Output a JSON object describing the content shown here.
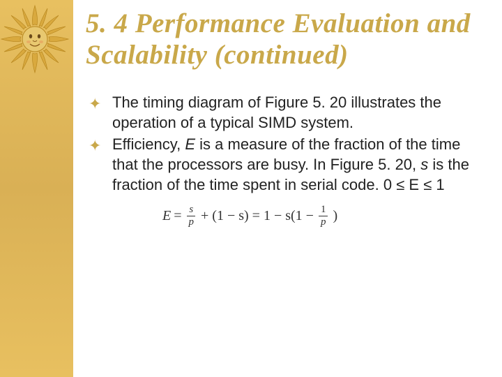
{
  "title": "5. 4 Performance Evaluation and Scalability (continued)",
  "bullets": [
    {
      "text": "The timing diagram of Figure 5. 20 illustrates the operation of a typical SIMD system."
    },
    {
      "pre": "Efficiency, ",
      "var1": "E",
      "mid": " is a measure of the fraction of the time that the processors are busy. In Figure 5. 20, ",
      "var2": "s",
      "post": " is the fraction of the time spent in serial code.  0 ≤ E ≤ 1"
    }
  ],
  "formula": {
    "lhs": "E",
    "eq1": "=",
    "f1num": "s",
    "f1den": "p",
    "plus": "+ (1 − s) = 1 − s(1 −",
    "f2num": "1",
    "f2den": "p",
    "close": ")"
  }
}
